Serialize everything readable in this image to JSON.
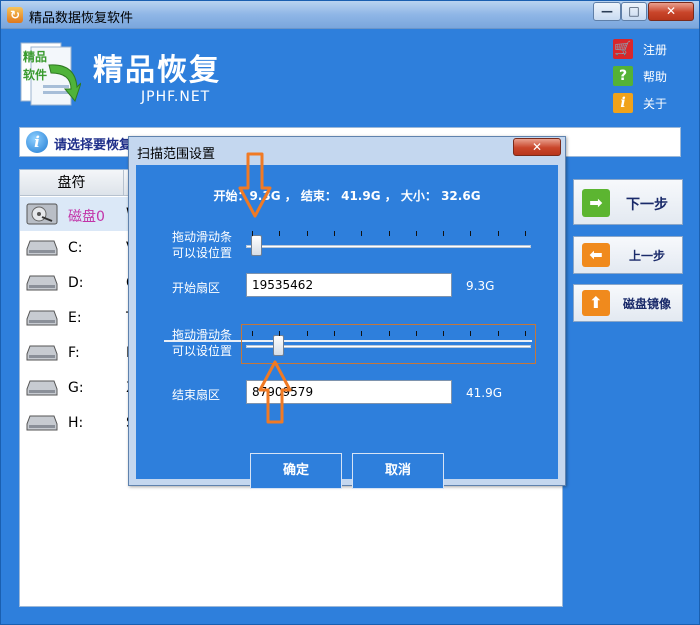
{
  "window": {
    "title": "精品数据恢复软件",
    "minimize": "—",
    "maximize": "□",
    "close": "✕"
  },
  "header": {
    "brand": "精品恢复",
    "brand_sub": "JPHF.NET",
    "logo_text": "精品软件"
  },
  "links": [
    {
      "icon": "cart-icon",
      "glyph": "🛒",
      "label": "注册",
      "color": "#d8262b"
    },
    {
      "icon": "help-icon",
      "glyph": "?",
      "label": "帮助",
      "color": "#54b236"
    },
    {
      "icon": "about-icon",
      "glyph": "i",
      "label": "关于",
      "color": "#f0a21a"
    }
  ],
  "info_bar": {
    "text": "请选择要恢复"
  },
  "list": {
    "header": "盘符",
    "rows": [
      {
        "name": "磁盘0",
        "trail": "W",
        "selected": true
      },
      {
        "name": "C:",
        "trail": "V"
      },
      {
        "name": "D:",
        "trail": "G"
      },
      {
        "name": "E:",
        "trail": "T"
      },
      {
        "name": "F:",
        "trail": "F"
      },
      {
        "name": "G:",
        "trail": "X"
      },
      {
        "name": "H:",
        "trail": "S"
      }
    ]
  },
  "side_buttons": [
    {
      "icon": "arrow-right-icon",
      "glyph": "➡",
      "label": "下一步",
      "color": "#5cb531"
    },
    {
      "icon": "arrow-left-icon",
      "glyph": "⬅",
      "label": "上一步",
      "color": "#f08a1d"
    },
    {
      "icon": "arrow-up-icon",
      "glyph": "⬆",
      "label": "磁盘镜像",
      "color": "#f08a1d"
    }
  ],
  "dialog": {
    "title": "扫描范围设置",
    "close": "✕",
    "summary": "开始：9.3G ， 结束： 41.9G ， 大小： 32.6G",
    "hint_line1": "拖动滑动条",
    "hint_line2": "可以设位置",
    "start_label": "开始扇区",
    "start_value": "19535462",
    "start_size": "9.3G",
    "end_label": "结束扇区",
    "end_value": "87909579",
    "end_size": "41.9G",
    "start_slider_fraction": 0.02,
    "end_slider_fraction": 0.1,
    "ok": "确定",
    "cancel": "取消"
  },
  "colors": {
    "window_blue": "#2e7fdc",
    "annotation_orange": "#f07a24"
  }
}
